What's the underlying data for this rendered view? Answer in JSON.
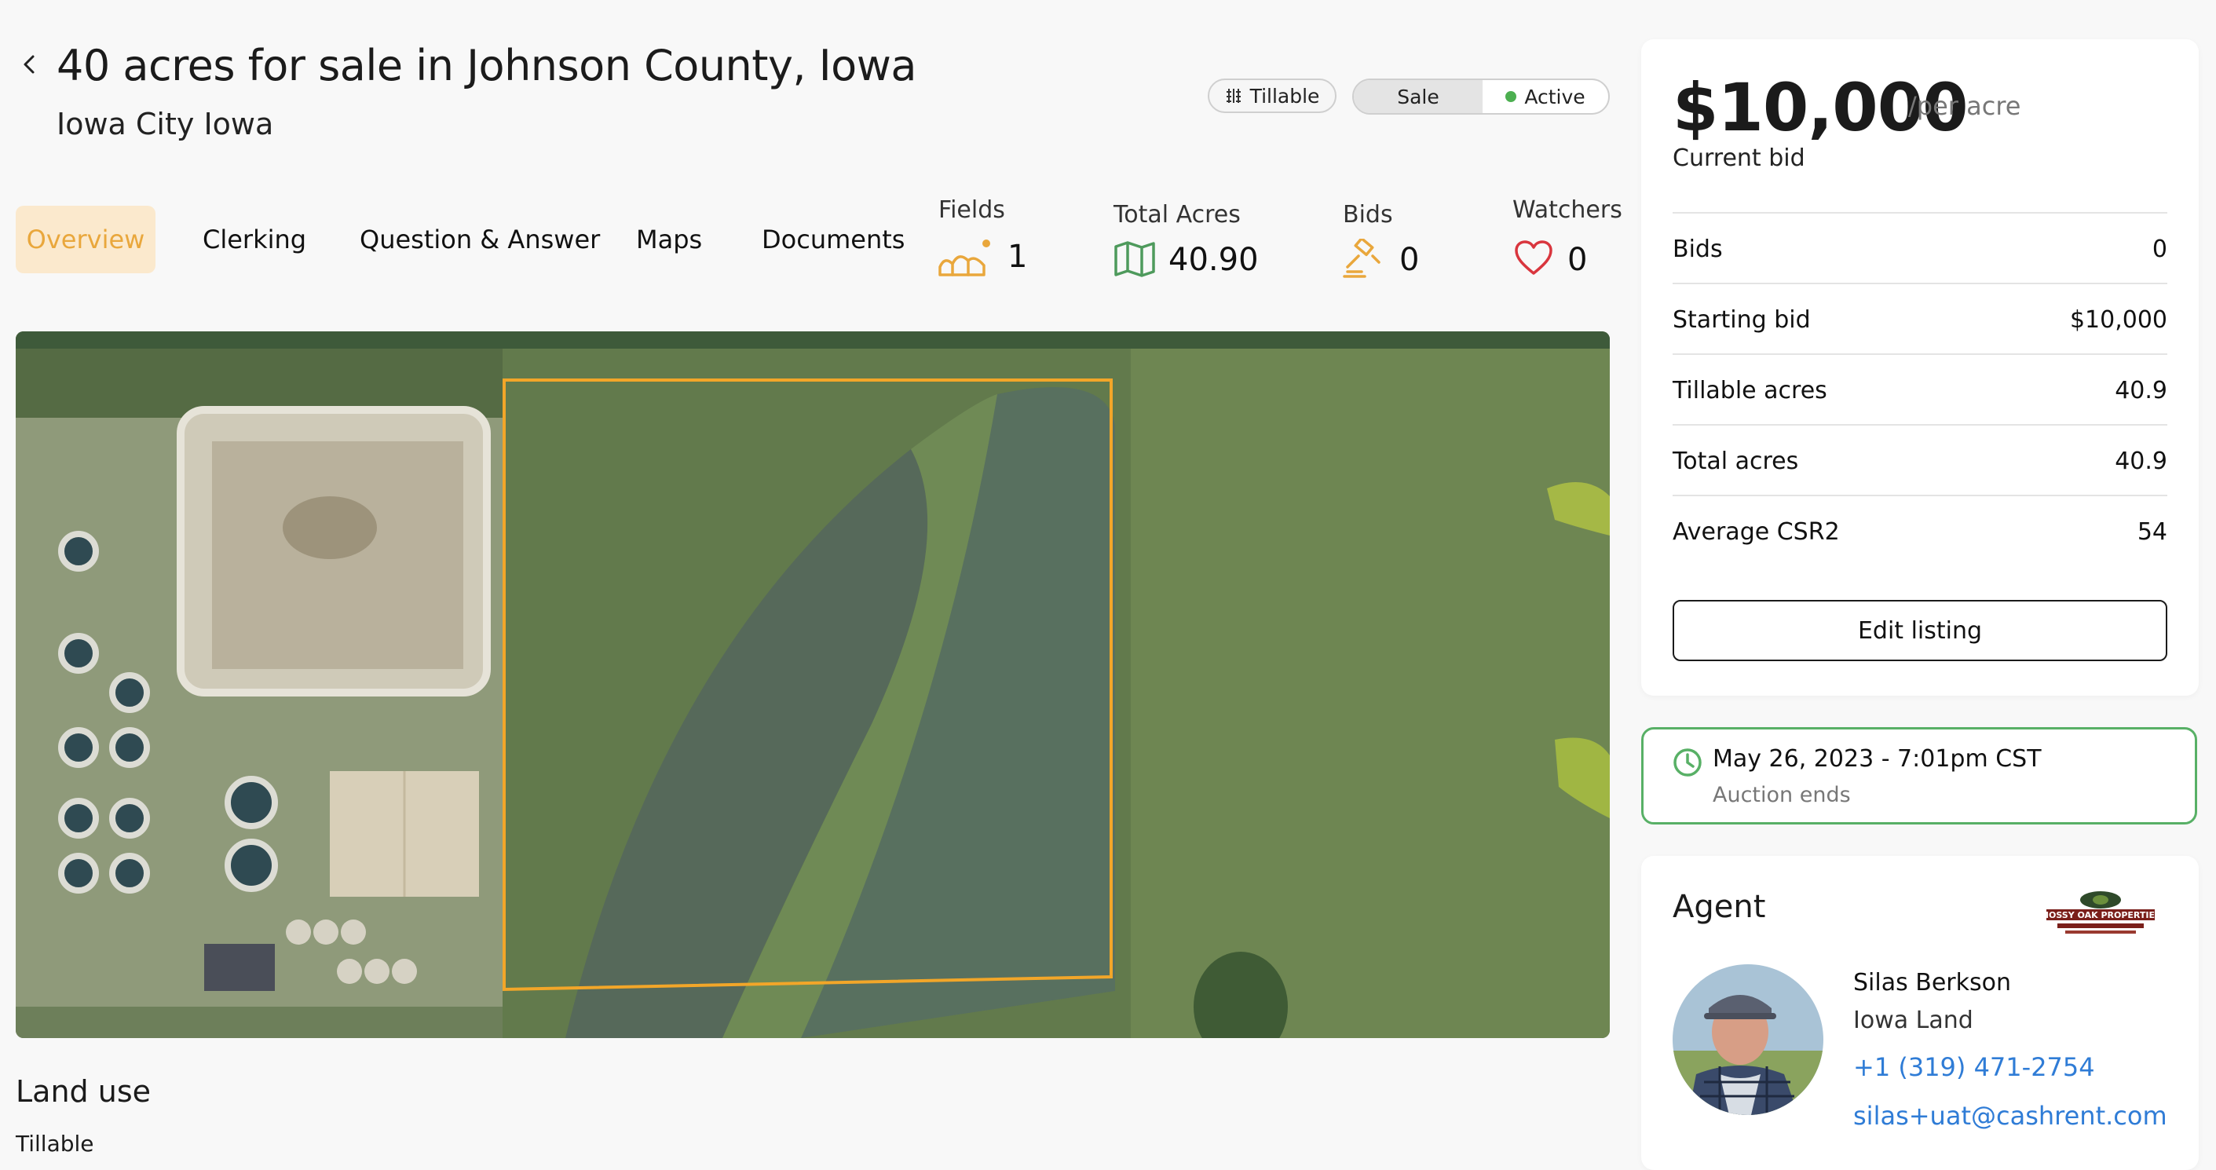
{
  "header": {
    "title": "40 acres for sale in Johnson County, Iowa",
    "subtitle": "Iowa City Iowa"
  },
  "chips": {
    "tillable": "Tillable",
    "sale": "Sale",
    "active": "Active"
  },
  "tabs": [
    {
      "label": "Overview"
    },
    {
      "label": "Clerking"
    },
    {
      "label": "Question & Answer"
    },
    {
      "label": "Maps"
    },
    {
      "label": "Documents"
    }
  ],
  "stats": {
    "fields": {
      "label": "Fields",
      "value": "1",
      "icon": "fields-icon"
    },
    "total_acres": {
      "label": "Total Acres",
      "value": "40.90",
      "icon": "map-icon"
    },
    "bids": {
      "label": "Bids",
      "value": "0",
      "icon": "gavel-icon"
    },
    "watchers": {
      "label": "Watchers",
      "value": "0",
      "icon": "heart-icon"
    }
  },
  "land_use": {
    "heading": "Land use",
    "value": "Tillable"
  },
  "bid_card": {
    "price": "$10,000",
    "unit": "/per acre",
    "current_label": "Current bid",
    "rows": [
      {
        "label": "Bids",
        "value": "0"
      },
      {
        "label": "Starting bid",
        "value": "$10,000"
      },
      {
        "label": "Tillable acres",
        "value": "40.9"
      },
      {
        "label": "Total acres",
        "value": "40.9"
      },
      {
        "label": "Average CSR2",
        "value": "54"
      }
    ],
    "edit_label": "Edit listing"
  },
  "auction": {
    "date": "May 26, 2023 - 7:01pm CST",
    "label": "Auction ends"
  },
  "agent": {
    "heading": "Agent",
    "name": "Silas Berkson",
    "company": "Iowa Land",
    "phone": "+1 (319) 471-2754",
    "email": "silas+uat@cashrent.com",
    "logo_text": "MOSSY OAK PROPERTIES"
  },
  "colors": {
    "accent": "#e9a73c",
    "accent_bg": "#fbe9cd",
    "active_green": "#4caf50",
    "link_blue": "#2f7cd6",
    "heart_red": "#d9363e"
  }
}
